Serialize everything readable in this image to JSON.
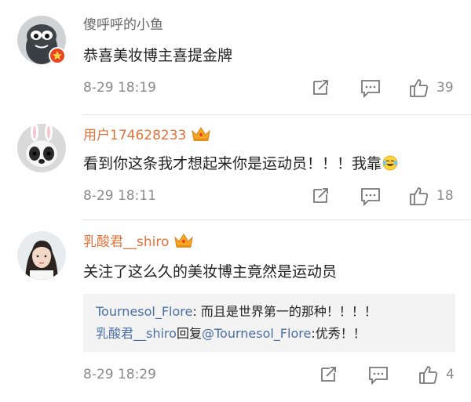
{
  "comments": [
    {
      "username": "傻呼呼的小鱼",
      "text": "恭喜美妆博主喜提金牌",
      "time": "8-29 18:19",
      "likes": "39",
      "verified": true
    },
    {
      "username": "用户174628233",
      "text": "看到你这条我才想起来你是运动员！！！我靠",
      "time": "8-29 18:11",
      "likes": "18",
      "has_crown": true,
      "emoji": "laughing-tears-icon"
    },
    {
      "username": "乳酸君__shiro",
      "text": "关注了这么久的美妆博主竟然是运动员",
      "time": "8-29 18:29",
      "likes": "4",
      "has_crown": true,
      "replies": [
        {
          "user": "Tournesol_Flore",
          "sep": ": ",
          "text": "而且是世界第一的那种！！！！"
        },
        {
          "user": "乳酸君__shiro",
          "mid": "回复",
          "target": "@Tournesol_Flore",
          "sep": ":",
          "text": "优秀！！"
        }
      ]
    }
  ],
  "colors": {
    "vip_name": "#e0733a",
    "link_blue": "#4a6fa5",
    "meta_grey": "#8a8a8a",
    "reply_bg": "#f3f3f3"
  }
}
